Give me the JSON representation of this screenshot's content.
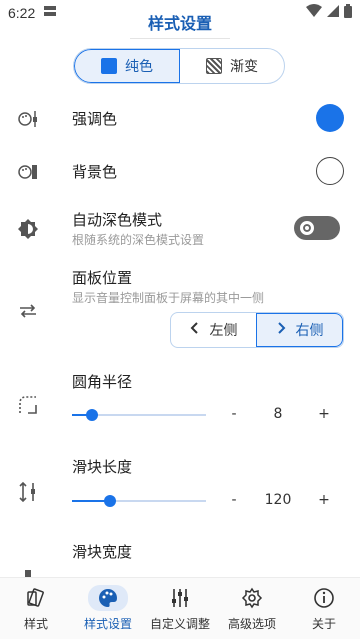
{
  "status": {
    "time": "6:22"
  },
  "title": "样式设置",
  "color_mode": {
    "options": [
      "纯色",
      "渐变"
    ],
    "selected": 0
  },
  "settings": {
    "accent": {
      "label": "强调色",
      "color": "#1a73e8"
    },
    "background": {
      "label": "背景色",
      "color": "#ffffff"
    },
    "dark_mode": {
      "label": "自动深色模式",
      "sub": "根随系统的深色模式设置",
      "enabled": false
    },
    "panel_position": {
      "label": "面板位置",
      "sub": "显示音量控制面板于屏幕的其中一侧",
      "options": [
        "左侧",
        "右侧"
      ],
      "selected": 1
    },
    "corner_radius": {
      "label": "圆角半径",
      "value": "8",
      "fraction": 0.15,
      "minus": "-",
      "plus": "+"
    },
    "slider_length": {
      "label": "滑块长度",
      "value": "120",
      "fraction": 0.28,
      "minus": "-",
      "plus": "+"
    },
    "slider_width": {
      "label": "滑块宽度"
    }
  },
  "nav": {
    "items": [
      {
        "label": "样式",
        "icon": "style-icon"
      },
      {
        "label": "样式设置",
        "icon": "palette-icon"
      },
      {
        "label": "自定义调整",
        "icon": "tune-icon"
      },
      {
        "label": "高级选项",
        "icon": "gear-icon"
      },
      {
        "label": "关于",
        "icon": "info-icon"
      }
    ],
    "active": 1
  },
  "colors": {
    "accent": "#1a73e8",
    "title": "#1a5fb4"
  }
}
